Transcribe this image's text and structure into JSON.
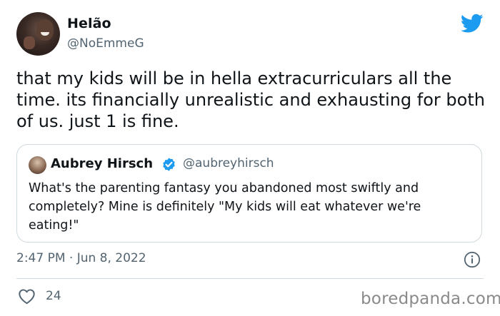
{
  "author": {
    "display_name": "Helão",
    "handle": "@NoEmmeG"
  },
  "tweet": {
    "text": "that my kids will be in hella extracurriculars all the time. its financially unrealistic and exhausting for both of us. just 1 is fine.",
    "timestamp": "2:47 PM · Jun 8, 2022",
    "like_count": "24"
  },
  "quoted_tweet": {
    "display_name": "Aubrey Hirsch",
    "handle": "@aubreyhirsch",
    "verified": true,
    "text": "What's the parenting fantasy you abandoned most swiftly and completely? Mine is definitely \"My kids will eat whatever we're eating!\""
  },
  "watermark": "boredpanda.com",
  "icons": {
    "logo": "twitter-bird-icon",
    "verified": "verified-badge-icon",
    "info": "info-icon",
    "like": "heart-icon"
  },
  "colors": {
    "twitter_blue": "#1d9bf0",
    "secondary_text": "#536471",
    "border": "#cfd9de"
  }
}
